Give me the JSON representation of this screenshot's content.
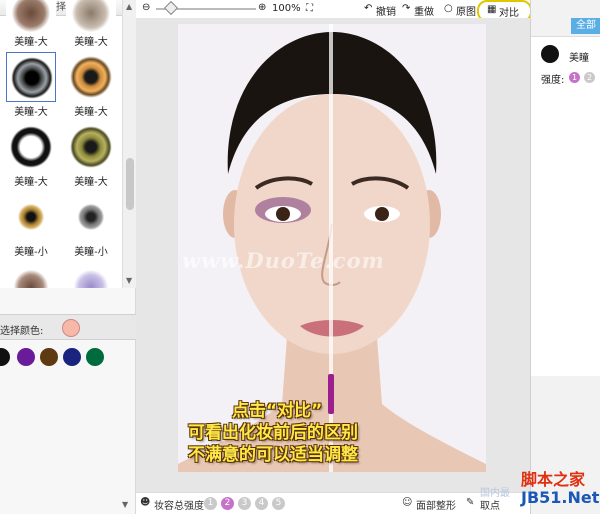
{
  "left_panel": {
    "header": "请选择形状",
    "shapes": [
      {
        "label": "美瞳-大",
        "col": 0,
        "row": 0
      },
      {
        "label": "美瞳-大",
        "col": 1,
        "row": 0
      },
      {
        "label": "美瞳-大",
        "col": 0,
        "row": 1,
        "selected": true
      },
      {
        "label": "美瞳-大",
        "col": 1,
        "row": 1
      },
      {
        "label": "美瞳-大",
        "col": 0,
        "row": 2
      },
      {
        "label": "美瞳-大",
        "col": 1,
        "row": 2
      },
      {
        "label": "美瞳-小",
        "col": 0,
        "row": 3
      },
      {
        "label": "美瞳-小",
        "col": 1,
        "row": 3
      }
    ],
    "color_label": "选择颜色:",
    "current_color": "#f7b8a8",
    "swatches": [
      "#111111",
      "#6a1b9a",
      "#5d3a12",
      "#1a237e",
      "#006b3c"
    ]
  },
  "toolbar": {
    "zoom": "100%",
    "undo": "撤销",
    "redo": "重做",
    "original": "原图",
    "compare": "对比"
  },
  "canvas": {
    "watermark": "www.DuoTe.com",
    "caption_1": "点击“对比”",
    "caption_2": "可看出化妆前后的区别",
    "caption_3": "不满意的可以适当调整"
  },
  "bottom": {
    "makeup_strength": "妆容总强度",
    "levels": [
      "1",
      "2",
      "3",
      "4",
      "5"
    ],
    "active_level": "2",
    "face_shape": "面部整形",
    "pick_color": "取点"
  },
  "right_panel": {
    "all_tab": "全部",
    "item": "美瞳",
    "strength_label": "强度:",
    "strength_levels": [
      "1",
      "2"
    ]
  },
  "branding": {
    "logo_line1": "脚本之家",
    "logo_line2": "JB51.Net",
    "ghost_text": "国内最"
  }
}
